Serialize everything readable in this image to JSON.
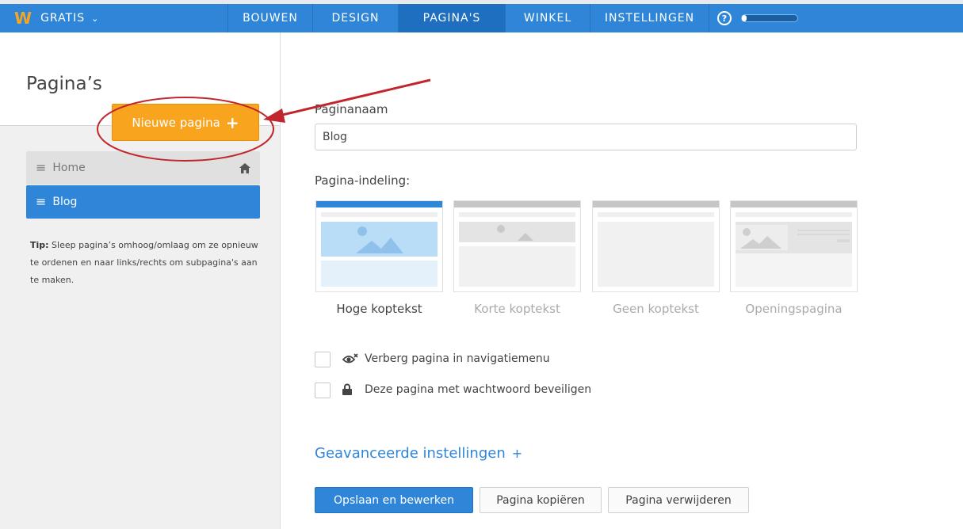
{
  "topbar": {
    "plan_label": "GRATIS",
    "tabs": [
      {
        "label": "BOUWEN",
        "active": false
      },
      {
        "label": "DESIGN",
        "active": false
      },
      {
        "label": "PAGINA'S",
        "active": true
      },
      {
        "label": "WINKEL",
        "active": false
      },
      {
        "label": "INSTELLINGEN",
        "active": false
      }
    ],
    "help_label": "?",
    "progress_fraction": 0.08,
    "colors": {
      "bar": "#2f86d9",
      "active_tab": "#1f6fc0",
      "logo": "#f4a623"
    }
  },
  "sidebar": {
    "title": "Pagina’s",
    "new_page_label": "Nieuwe pagina",
    "new_page_plus": "+",
    "pages": [
      {
        "label": "Home",
        "selected": false,
        "icon": "home-icon"
      },
      {
        "label": "Blog",
        "selected": true
      }
    ],
    "tip_label": "Tip:",
    "tip_text": "Sleep pagina’s omhoog/omlaag om ze opnieuw te ordenen en naar links/rechts om subpagina's aan te maken."
  },
  "main": {
    "page_name_label": "Paginanaam",
    "page_name_value": "Blog",
    "layout_label": "Pagina-indeling:",
    "layouts": [
      {
        "name": "Hoge koptekst",
        "selected": true
      },
      {
        "name": "Korte koptekst",
        "selected": false
      },
      {
        "name": "Geen koptekst",
        "selected": false
      },
      {
        "name": "Openingspagina",
        "selected": false
      }
    ],
    "options": [
      {
        "label": "Verberg pagina in navigatiemenu",
        "icon": "hidden-eye-icon",
        "checked": false
      },
      {
        "label": "Deze pagina met wachtwoord beveiligen",
        "icon": "lock-icon",
        "checked": false
      }
    ],
    "advanced_label": "Geavanceerde instellingen",
    "advanced_plus": "+",
    "buttons": {
      "save": "Opslaan en bewerken",
      "copy": "Pagina kopiëren",
      "delete": "Pagina verwijderen"
    }
  },
  "annotation_color": "#c0262b"
}
